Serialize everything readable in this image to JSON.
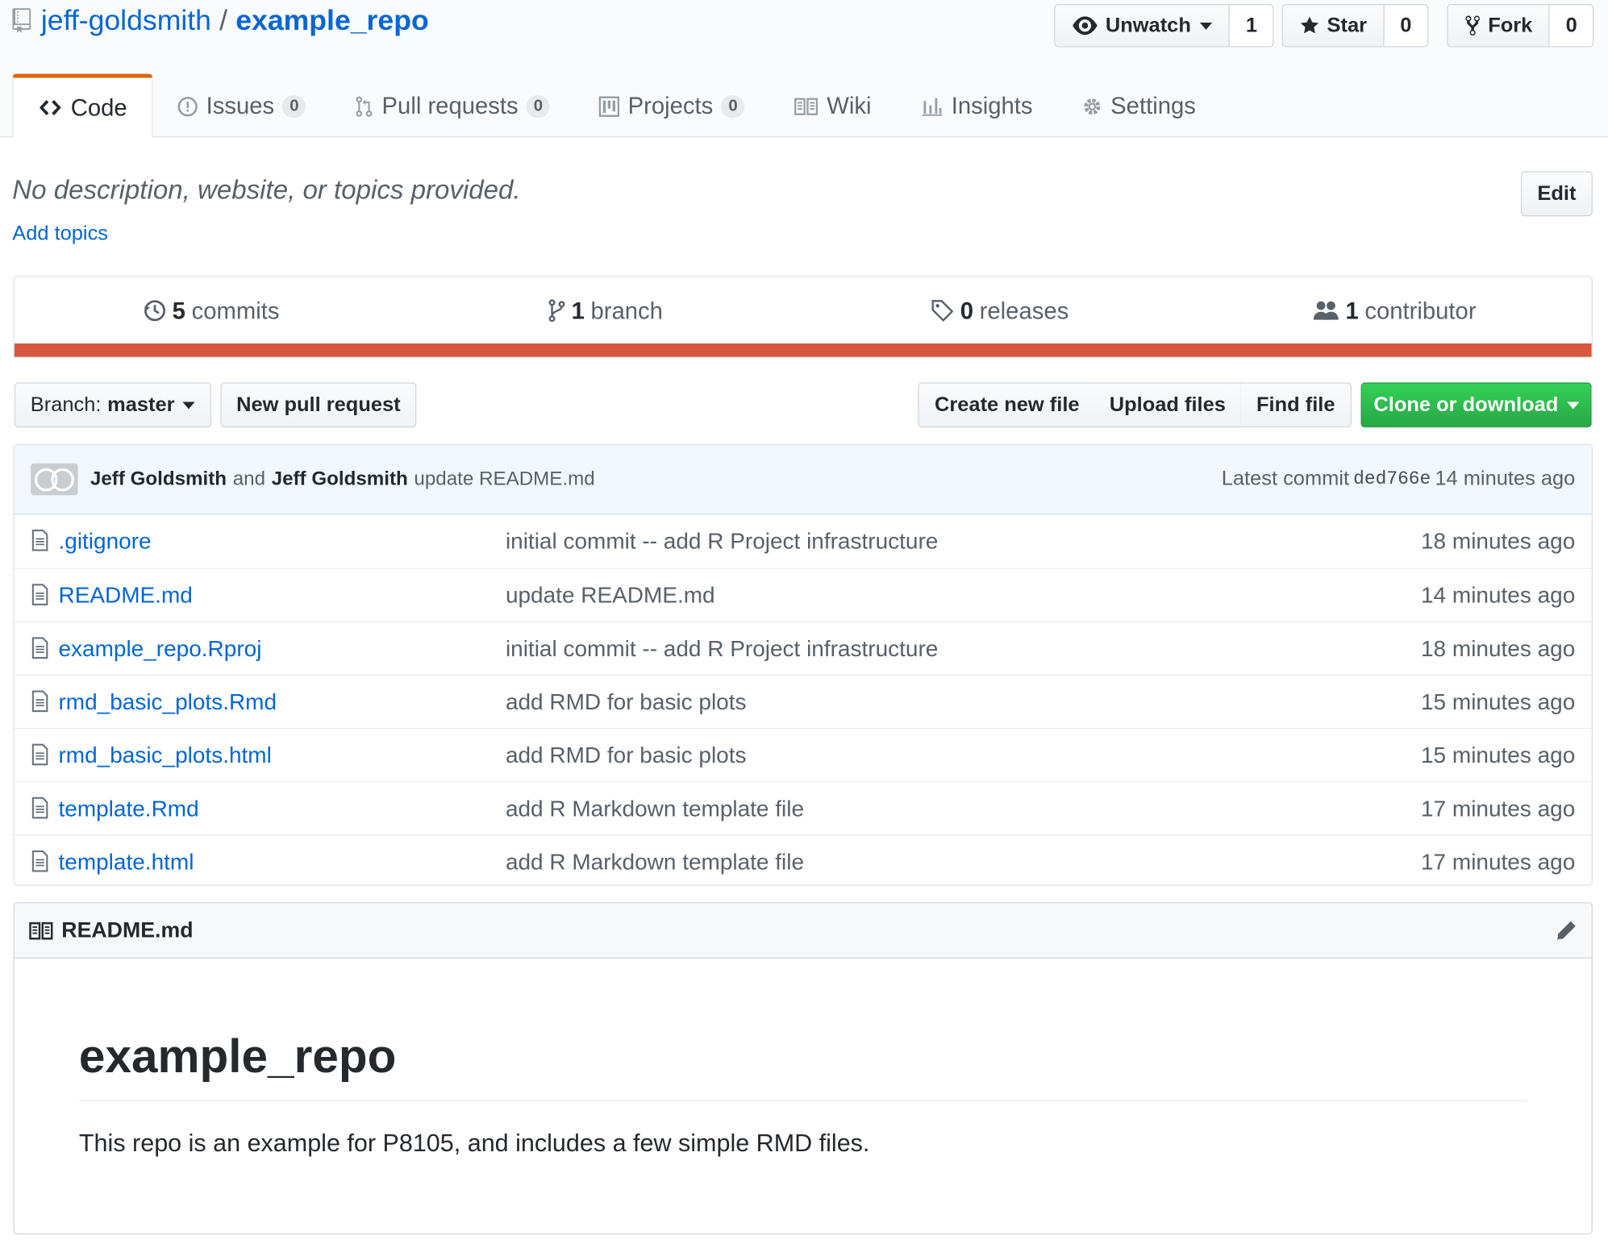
{
  "repo": {
    "owner": "jeff-goldsmith",
    "separator": "/",
    "name": "example_repo"
  },
  "social": {
    "watch": {
      "label": "Unwatch",
      "count": "1"
    },
    "star": {
      "label": "Star",
      "count": "0"
    },
    "fork": {
      "label": "Fork",
      "count": "0"
    }
  },
  "tabs": [
    {
      "label": "Code",
      "icon": "code-icon"
    },
    {
      "label": "Issues",
      "icon": "issue-icon",
      "count": "0"
    },
    {
      "label": "Pull requests",
      "icon": "pull-request-icon",
      "count": "0"
    },
    {
      "label": "Projects",
      "icon": "project-icon",
      "count": "0"
    },
    {
      "label": "Wiki",
      "icon": "book-icon"
    },
    {
      "label": "Insights",
      "icon": "graph-icon"
    },
    {
      "label": "Settings",
      "icon": "gear-icon"
    }
  ],
  "description": {
    "text": "No description, website, or topics provided.",
    "add_topics": "Add topics",
    "edit_label": "Edit"
  },
  "summary": {
    "commits": {
      "num": "5",
      "label": "commits"
    },
    "branches": {
      "num": "1",
      "label": "branch"
    },
    "releases": {
      "num": "0",
      "label": "releases"
    },
    "contributors": {
      "num": "1",
      "label": "contributor"
    },
    "language_color": "#d6573d"
  },
  "file_nav": {
    "branch_prefix": "Branch:",
    "branch_name": "master",
    "new_pr": "New pull request",
    "create_file": "Create new file",
    "upload_files": "Upload files",
    "find_file": "Find file",
    "clone": "Clone or download"
  },
  "commit_tease": {
    "author": "Jeff Goldsmith",
    "and": "and",
    "committer": "Jeff Goldsmith",
    "message": "update README.md",
    "latest_label": "Latest commit",
    "sha": "ded766e",
    "age": "14 minutes ago"
  },
  "files": [
    {
      "name": ".gitignore",
      "message": "initial commit -- add R Project infrastructure",
      "age": "18 minutes ago"
    },
    {
      "name": "README.md",
      "message": "update README.md",
      "age": "14 minutes ago"
    },
    {
      "name": "example_repo.Rproj",
      "message": "initial commit -- add R Project infrastructure",
      "age": "18 minutes ago"
    },
    {
      "name": "rmd_basic_plots.Rmd",
      "message": "add RMD for basic plots",
      "age": "15 minutes ago"
    },
    {
      "name": "rmd_basic_plots.html",
      "message": "add RMD for basic plots",
      "age": "15 minutes ago"
    },
    {
      "name": "template.Rmd",
      "message": "add R Markdown template file",
      "age": "17 minutes ago"
    },
    {
      "name": "template.html",
      "message": "add R Markdown template file",
      "age": "17 minutes ago"
    }
  ],
  "readme": {
    "filename": "README.md",
    "heading": "example_repo",
    "body": "This repo is an example for P8105, and includes a few simple RMD files."
  }
}
